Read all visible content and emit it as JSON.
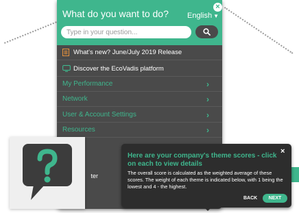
{
  "help_panel": {
    "title": "What do you want to do?",
    "language": "English",
    "close_icon": "×",
    "search_placeholder": "Type in your question...",
    "items": [
      {
        "label": "What's new? June/July 2019 Release",
        "icon": "document-icon"
      },
      {
        "label": "Discover the EcoVadis platform",
        "icon": "monitor-icon"
      }
    ],
    "sections": [
      {
        "label": "My Performance"
      },
      {
        "label": "Network"
      },
      {
        "label": "User & Account Settings"
      },
      {
        "label": "Resources"
      }
    ],
    "footer_fragment": "ter"
  },
  "tooltip": {
    "title": "Here are your company's theme scores - click on each to view details",
    "body": "The overall score is calculated as the weighted average of these scores. The weight of each theme is indicated below, with 1 being the lowest and 4 - the highest.",
    "back_label": "BACK",
    "next_label": "NEXT",
    "close_icon": "×"
  },
  "colors": {
    "accent": "#3fb68d",
    "panel_bg": "#4a4a4a",
    "tooltip_bg": "#2d2d2d",
    "icon_orange": "#e8923c"
  }
}
